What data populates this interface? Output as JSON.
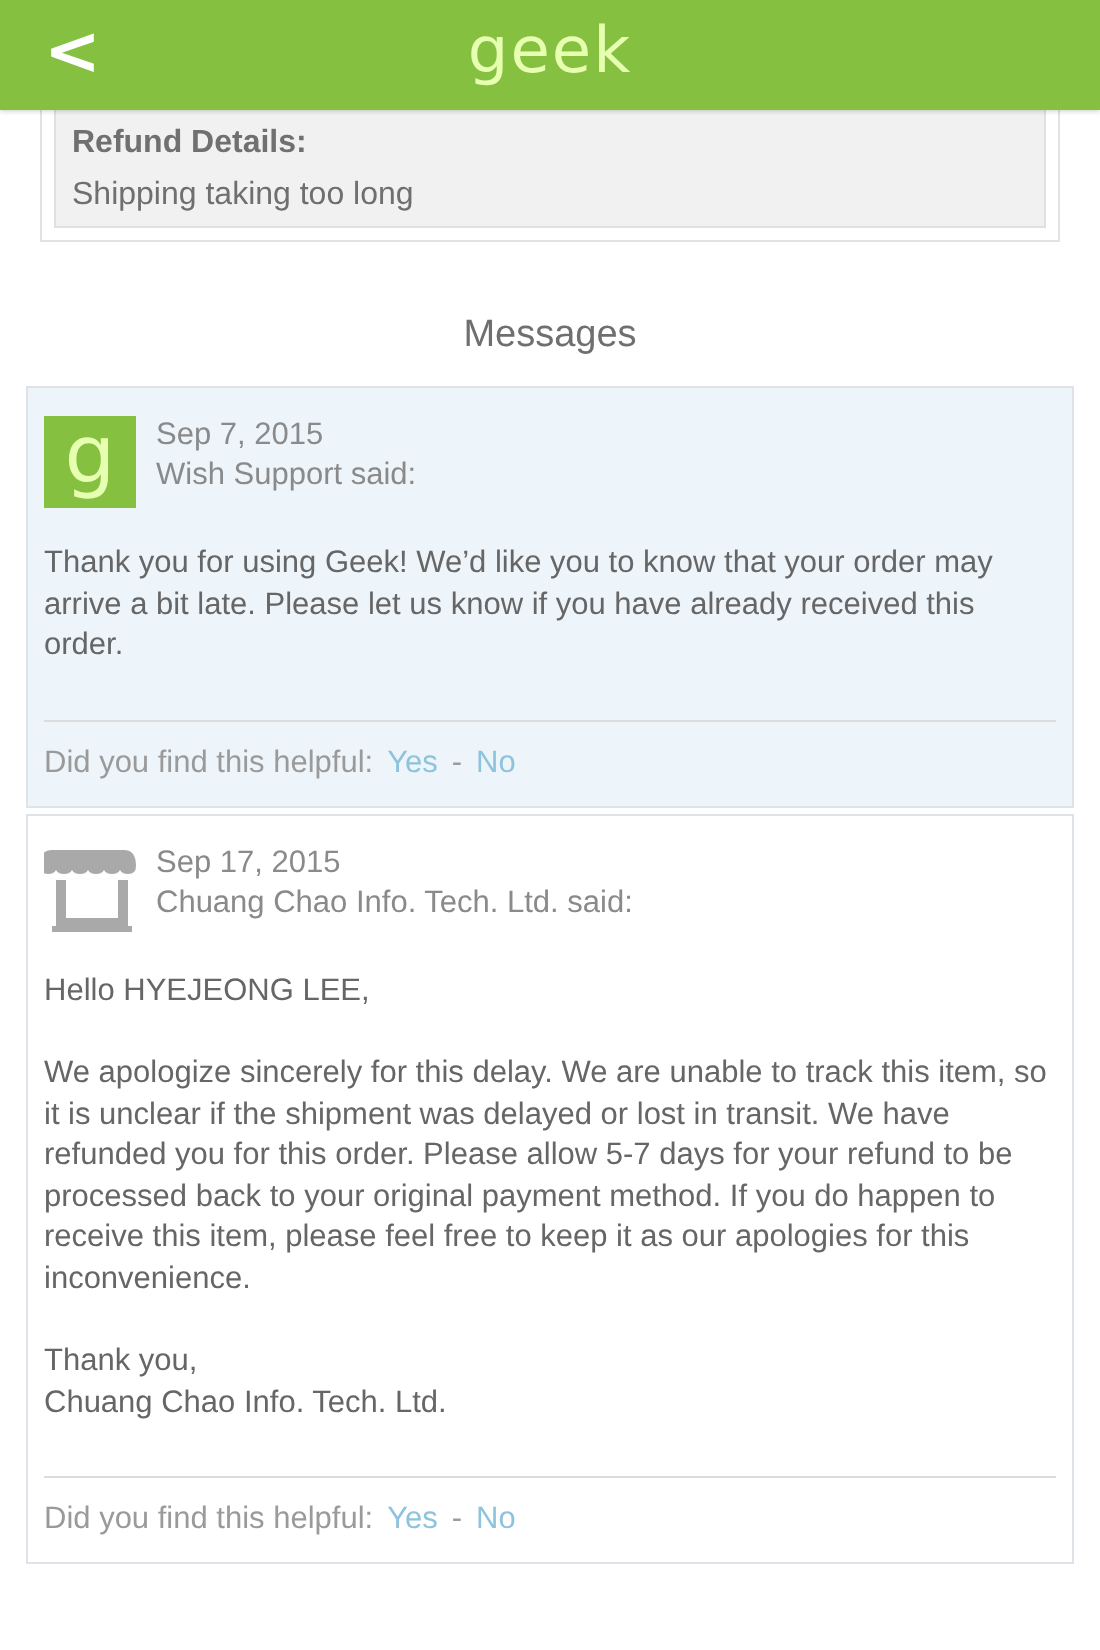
{
  "header": {
    "back": "<",
    "logo": "geek"
  },
  "refund": {
    "label": "Refund Details:",
    "reason": "Shipping taking too long"
  },
  "messages_title": "Messages",
  "messages": [
    {
      "kind": "support",
      "avatar": "g",
      "date": "Sep 7, 2015",
      "author": "Wish Support said:",
      "paragraphs": [
        "Thank you for using Geek! We’d like you to know that your order may arrive a bit late. Please let us know if you have already received this order."
      ],
      "feedback": {
        "question": "Did you find this helpful:",
        "yes": "Yes",
        "separator": "-",
        "no": "No"
      }
    },
    {
      "kind": "seller",
      "date": "Sep 17, 2015",
      "author": "Chuang Chao Info. Tech. Ltd. said:",
      "paragraphs": [
        "Hello HYEJEONG LEE,",
        "We apologize sincerely for this delay. We are unable to track this item, so it is unclear if the shipment was delayed or lost in transit. We have refunded you for this order. Please allow 5-7 days for your refund to be processed back to your original payment method. If you do happen to receive this item, please feel free to keep it as our apologies for this inconvenience.",
        "Thank you,\nChuang Chao Info. Tech. Ltd."
      ],
      "feedback": {
        "question": "Did you find this helpful:",
        "yes": "Yes",
        "separator": "-",
        "no": "No"
      }
    }
  ]
}
